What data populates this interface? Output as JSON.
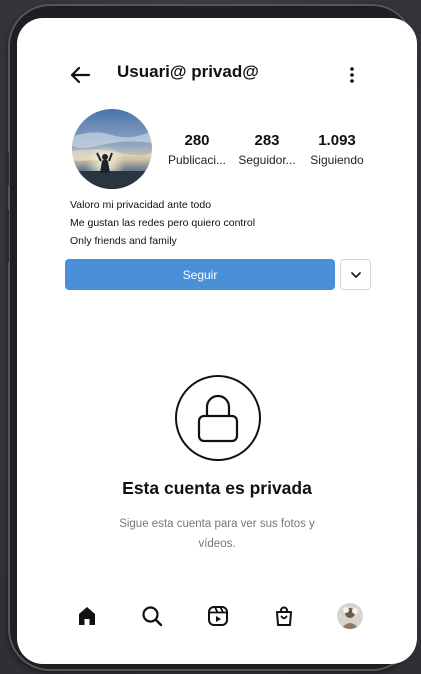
{
  "header": {
    "title": "Usuari@ privad@"
  },
  "profile": {
    "stats": [
      {
        "value": "280",
        "label": "Publicaci..."
      },
      {
        "value": "283",
        "label": "Seguidor..."
      },
      {
        "value": "1.093",
        "label": "Siguiendo"
      }
    ],
    "bio": [
      "Valoro mi privacidad ante todo",
      "Me gustan las redes pero quiero control",
      "Only friends and family"
    ],
    "follow_label": "Seguir"
  },
  "private_notice": {
    "title": "Esta cuenta es privada",
    "subtitle": "Sigue esta cuenta para ver sus fotos y vídeos."
  },
  "bottom_nav": [
    "home-icon",
    "search-icon",
    "reels-icon",
    "shop-icon",
    "profile-avatar"
  ],
  "colors": {
    "accent": "#4a90d9",
    "background": "#ffffff",
    "frame": "#1e1f22"
  }
}
